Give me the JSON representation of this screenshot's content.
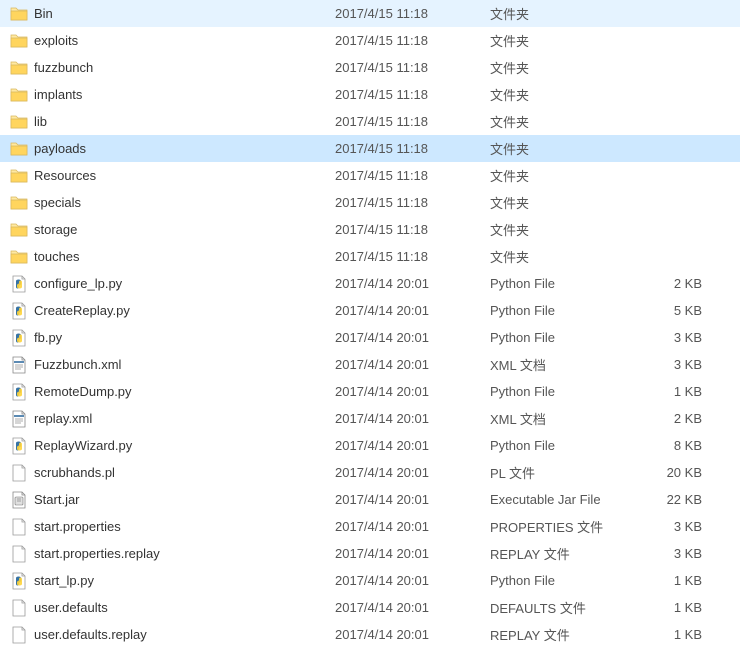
{
  "selected_index": 5,
  "files": [
    {
      "name": "Bin",
      "date": "2017/4/15 11:18",
      "type": "文件夹",
      "size": "",
      "icon": "folder"
    },
    {
      "name": "exploits",
      "date": "2017/4/15 11:18",
      "type": "文件夹",
      "size": "",
      "icon": "folder"
    },
    {
      "name": "fuzzbunch",
      "date": "2017/4/15 11:18",
      "type": "文件夹",
      "size": "",
      "icon": "folder"
    },
    {
      "name": "implants",
      "date": "2017/4/15 11:18",
      "type": "文件夹",
      "size": "",
      "icon": "folder"
    },
    {
      "name": "lib",
      "date": "2017/4/15 11:18",
      "type": "文件夹",
      "size": "",
      "icon": "folder"
    },
    {
      "name": "payloads",
      "date": "2017/4/15 11:18",
      "type": "文件夹",
      "size": "",
      "icon": "folder"
    },
    {
      "name": "Resources",
      "date": "2017/4/15 11:18",
      "type": "文件夹",
      "size": "",
      "icon": "folder"
    },
    {
      "name": "specials",
      "date": "2017/4/15 11:18",
      "type": "文件夹",
      "size": "",
      "icon": "folder"
    },
    {
      "name": "storage",
      "date": "2017/4/15 11:18",
      "type": "文件夹",
      "size": "",
      "icon": "folder"
    },
    {
      "name": "touches",
      "date": "2017/4/15 11:18",
      "type": "文件夹",
      "size": "",
      "icon": "folder"
    },
    {
      "name": "configure_lp.py",
      "date": "2017/4/14 20:01",
      "type": "Python File",
      "size": "2 KB",
      "icon": "python"
    },
    {
      "name": "CreateReplay.py",
      "date": "2017/4/14 20:01",
      "type": "Python File",
      "size": "5 KB",
      "icon": "python"
    },
    {
      "name": "fb.py",
      "date": "2017/4/14 20:01",
      "type": "Python File",
      "size": "3 KB",
      "icon": "python"
    },
    {
      "name": "Fuzzbunch.xml",
      "date": "2017/4/14 20:01",
      "type": "XML 文档",
      "size": "3 KB",
      "icon": "xml"
    },
    {
      "name": "RemoteDump.py",
      "date": "2017/4/14 20:01",
      "type": "Python File",
      "size": "1 KB",
      "icon": "python"
    },
    {
      "name": "replay.xml",
      "date": "2017/4/14 20:01",
      "type": "XML 文档",
      "size": "2 KB",
      "icon": "xml"
    },
    {
      "name": "ReplayWizard.py",
      "date": "2017/4/14 20:01",
      "type": "Python File",
      "size": "8 KB",
      "icon": "python"
    },
    {
      "name": "scrubhands.pl",
      "date": "2017/4/14 20:01",
      "type": "PL 文件",
      "size": "20 KB",
      "icon": "file"
    },
    {
      "name": "Start.jar",
      "date": "2017/4/14 20:01",
      "type": "Executable Jar File",
      "size": "22 KB",
      "icon": "jar"
    },
    {
      "name": "start.properties",
      "date": "2017/4/14 20:01",
      "type": "PROPERTIES 文件",
      "size": "3 KB",
      "icon": "file"
    },
    {
      "name": "start.properties.replay",
      "date": "2017/4/14 20:01",
      "type": "REPLAY 文件",
      "size": "3 KB",
      "icon": "file"
    },
    {
      "name": "start_lp.py",
      "date": "2017/4/14 20:01",
      "type": "Python File",
      "size": "1 KB",
      "icon": "python"
    },
    {
      "name": "user.defaults",
      "date": "2017/4/14 20:01",
      "type": "DEFAULTS 文件",
      "size": "1 KB",
      "icon": "file"
    },
    {
      "name": "user.defaults.replay",
      "date": "2017/4/14 20:01",
      "type": "REPLAY 文件",
      "size": "1 KB",
      "icon": "file"
    }
  ]
}
